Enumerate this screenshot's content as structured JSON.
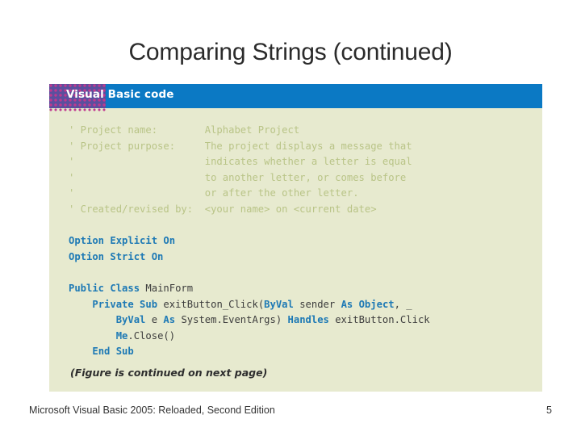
{
  "slide": {
    "title": "Comparing Strings (continued)"
  },
  "figure": {
    "banner_label": "Visual Basic code",
    "continued_note": "(Figure is continued on next page)",
    "colors": {
      "banner_blue": "#0b79c4",
      "banner_underline": "#3f9ad4",
      "banner_dots_purple": "#5b4f9e",
      "banner_dots_magenta": "#c0398f",
      "code_background": "#e7eacf",
      "comment_green": "#b9c487",
      "keyword_blue": "#1d79b5",
      "identifier_gray": "#3c3c3c"
    },
    "code_lines": [
      {
        "id": "l01",
        "segments": [
          {
            "kind": "comment",
            "text": "' Project name:        Alphabet Project"
          }
        ]
      },
      {
        "id": "l02",
        "segments": [
          {
            "kind": "comment",
            "text": "' Project purpose:     The project displays a message that"
          }
        ]
      },
      {
        "id": "l03",
        "segments": [
          {
            "kind": "comment",
            "text": "'                      indicates whether a letter is equal"
          }
        ]
      },
      {
        "id": "l04",
        "segments": [
          {
            "kind": "comment",
            "text": "'                      to another letter, or comes before"
          }
        ]
      },
      {
        "id": "l05",
        "segments": [
          {
            "kind": "comment",
            "text": "'                      or after the other letter."
          }
        ]
      },
      {
        "id": "l06",
        "segments": [
          {
            "kind": "comment",
            "text": "' Created/revised by:  <your name> on <current date>"
          }
        ]
      },
      {
        "id": "l07",
        "segments": [
          {
            "kind": "blank",
            "text": " "
          }
        ]
      },
      {
        "id": "l08",
        "segments": [
          {
            "kind": "kw",
            "text": "Option Explicit On"
          }
        ]
      },
      {
        "id": "l09",
        "segments": [
          {
            "kind": "kw",
            "text": "Option Strict On"
          }
        ]
      },
      {
        "id": "l10",
        "segments": [
          {
            "kind": "blank",
            "text": " "
          }
        ]
      },
      {
        "id": "l11",
        "segments": [
          {
            "kind": "kw",
            "text": "Public Class "
          },
          {
            "kind": "id",
            "text": "MainForm"
          }
        ]
      },
      {
        "id": "l12",
        "segments": [
          {
            "kind": "id",
            "text": "    "
          },
          {
            "kind": "kw",
            "text": "Private Sub "
          },
          {
            "kind": "id",
            "text": "exitButton_Click("
          },
          {
            "kind": "kw",
            "text": "ByVal "
          },
          {
            "kind": "id",
            "text": "sender "
          },
          {
            "kind": "kw",
            "text": "As Object"
          },
          {
            "kind": "id",
            "text": ", _"
          }
        ]
      },
      {
        "id": "l13",
        "segments": [
          {
            "kind": "id",
            "text": "        "
          },
          {
            "kind": "kw",
            "text": "ByVal "
          },
          {
            "kind": "id",
            "text": "e "
          },
          {
            "kind": "kw",
            "text": "As "
          },
          {
            "kind": "id",
            "text": "System.EventArgs) "
          },
          {
            "kind": "kw",
            "text": "Handles "
          },
          {
            "kind": "id",
            "text": "exitButton.Click"
          }
        ]
      },
      {
        "id": "l14",
        "segments": [
          {
            "kind": "id",
            "text": "        "
          },
          {
            "kind": "kw",
            "text": "Me"
          },
          {
            "kind": "id",
            "text": ".Close()"
          }
        ]
      },
      {
        "id": "l15",
        "segments": [
          {
            "kind": "id",
            "text": "    "
          },
          {
            "kind": "kw",
            "text": "End Sub"
          }
        ]
      }
    ]
  },
  "footer": {
    "source": "Microsoft Visual Basic 2005: Reloaded, Second Edition",
    "page_number": "5"
  }
}
